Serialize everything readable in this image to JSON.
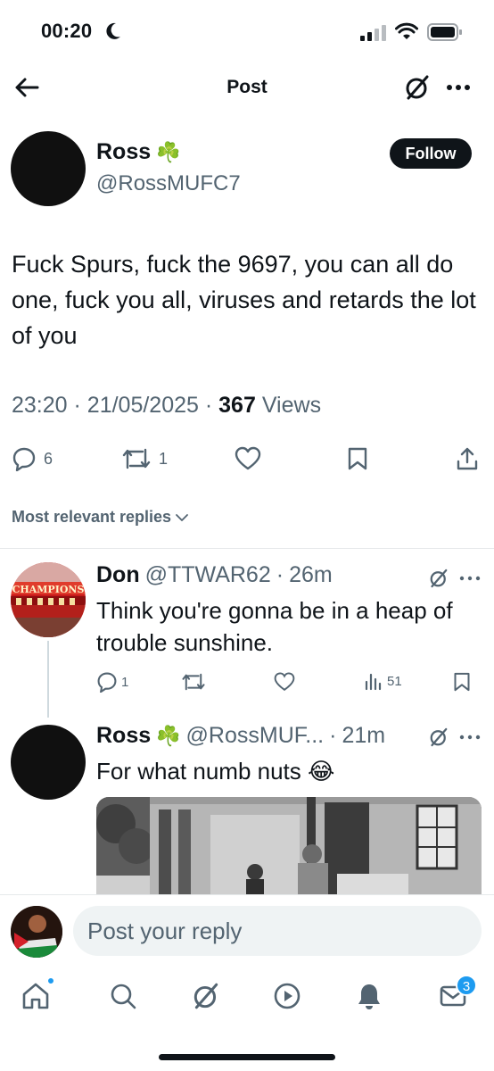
{
  "status_bar": {
    "time": "00:20"
  },
  "nav": {
    "title": "Post"
  },
  "post": {
    "author_name": "Ross",
    "author_emoji": "☘️",
    "handle": "@RossMUFC7",
    "follow_label": "Follow",
    "text": "Fuck Spurs, fuck the 9697, you can all do one, fuck you all, viruses and retards the lot of you",
    "time": "23:20",
    "date": "21/05/2025",
    "views_count": "367",
    "views_label": "Views",
    "replies_count": "6",
    "reposts_count": "1"
  },
  "sort": {
    "label": "Most relevant replies"
  },
  "replies": [
    {
      "name": "Don",
      "handle": "@TTWAR62",
      "age": "26m",
      "text": "Think you're gonna be in a heap of trouble sunshine.",
      "avatar_text": "CHAMPIONS",
      "reply_count": "1",
      "views": "51"
    },
    {
      "name": "Ross",
      "emoji": "☘️",
      "handle": "@RossMUF...",
      "age": "21m",
      "text": "For what numb nuts 😂"
    }
  ],
  "composer": {
    "placeholder": "Post your reply"
  },
  "tabbar": {
    "messages_badge": "3"
  },
  "colors": {
    "accent": "#1d9bf0",
    "text": "#0f1419",
    "muted": "#536471"
  }
}
